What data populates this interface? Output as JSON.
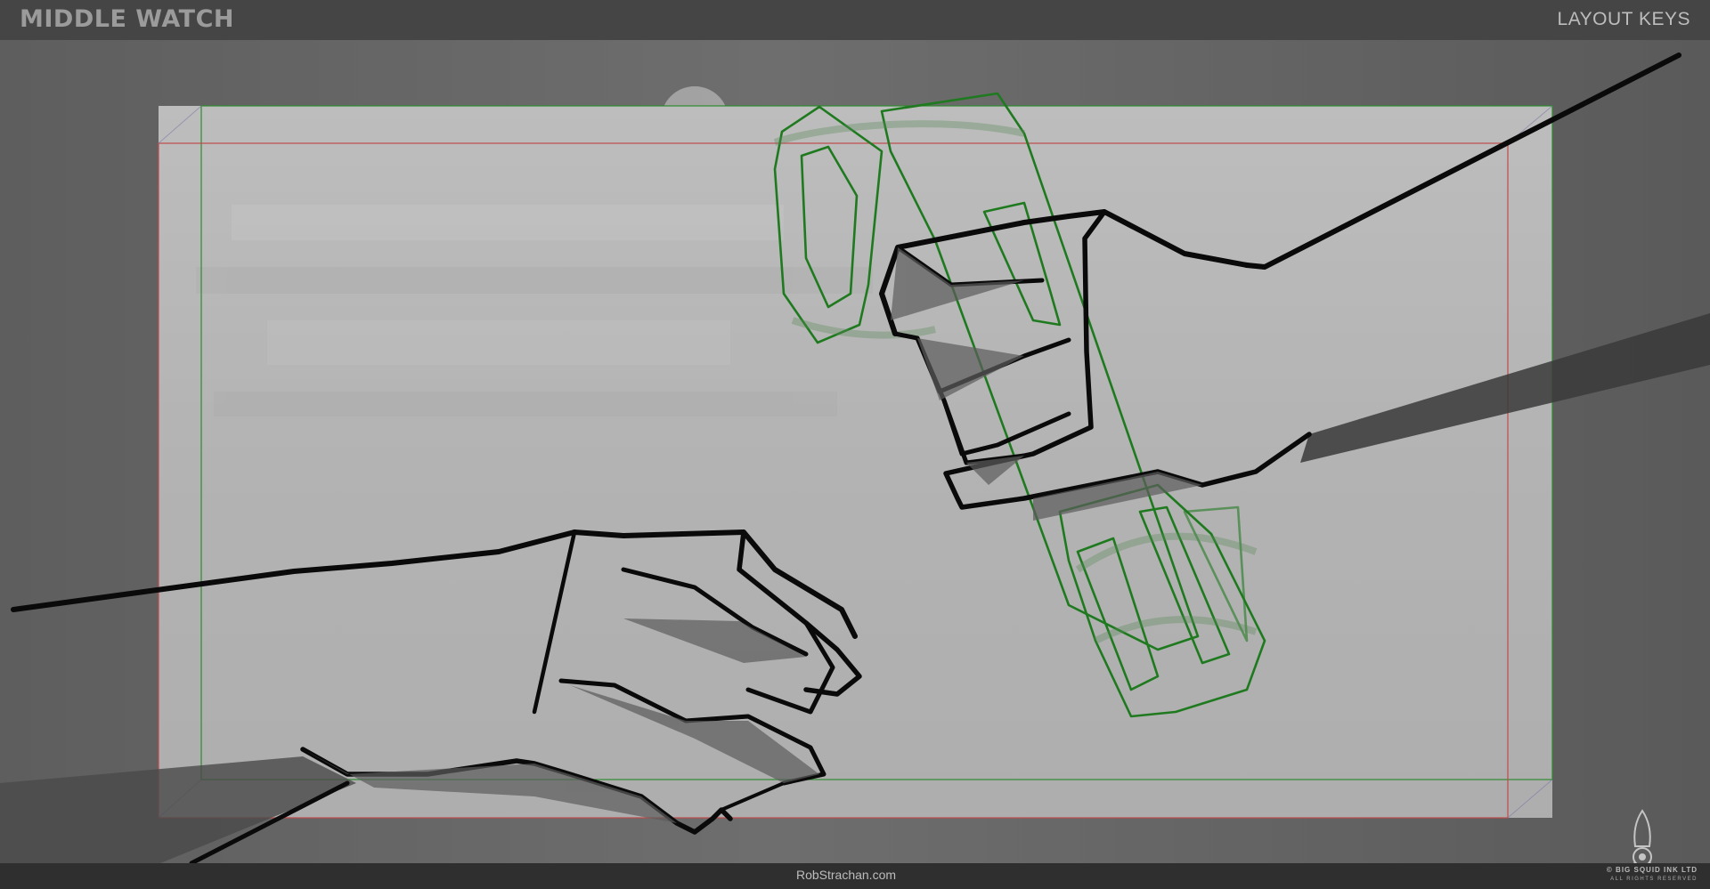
{
  "header": {
    "title": "MIDDLE WATCH",
    "section": "LAYOUT KEYS"
  },
  "footer": {
    "credit": "RobStrachan.com",
    "copyright": "© BIG SQUID INK LTD",
    "rights": "ALL RIGHTS RESERVED"
  },
  "colors": {
    "frame_safe": "#2f8a2f",
    "frame_action": "#c04a4a",
    "prop_outline": "#1f7a1f",
    "ink": "#0a0a0a"
  },
  "icons": {
    "logo": "squid-logo-icon"
  }
}
